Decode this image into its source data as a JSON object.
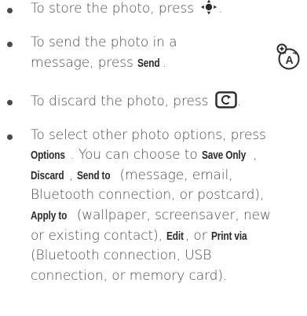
{
  "bullets": [
    {
      "pre": "To store the photo, press ",
      "icon": "center-nav-key-icon",
      "post": "."
    },
    {
      "line1": "To send the photo in a",
      "line2_pre": "message, press ",
      "key": "Send",
      "line2_post": "."
    },
    {
      "pre": "To discard the photo, press ",
      "icon": "back-key-icon",
      "post": "."
    },
    {
      "l1": "To select other photo options, press",
      "l2_k1": "Options",
      "l2_t1": ". You can choose to ",
      "l2_k2": "Save Only",
      "l2_t2": ",",
      "l3_k1": "Discard",
      "l3_t1": ", ",
      "l3_k2": "Send to",
      "l3_t2": " (message, email,",
      "l4": "Bluetooth connection, or postcard),",
      "l5_k1": "Apply to",
      "l5_t1": " (wallpaper, screensaver, new",
      "l6_pre": "or existing contact), ",
      "l6_k1": "Edit",
      "l6_t1": ", or ",
      "l6_k2": "Print via",
      "l7": "(Bluetooth connection, USB",
      "l8": "connection, or memory card)."
    }
  ],
  "side_icon": "network-feature-icon",
  "colors": {
    "text": "#4a4a4a",
    "key": "#2b2b2b"
  }
}
